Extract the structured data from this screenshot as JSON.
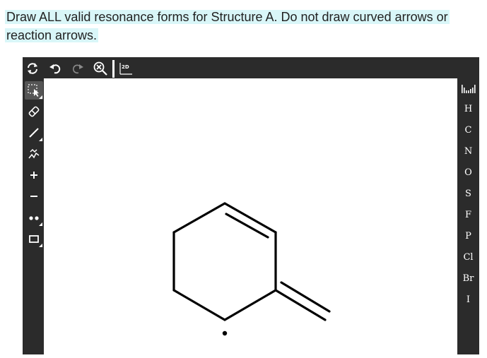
{
  "question": {
    "text": "Draw ALL valid resonance forms for Structure A. Do not draw curved arrows or reaction arrows."
  },
  "toolbar": {
    "tools": [
      "refresh-icon",
      "undo-icon",
      "redo-icon",
      "zoom-clear-icon",
      "layout-2d-icon"
    ],
    "layout_label": "2D"
  },
  "left_tools": [
    "select",
    "erase",
    "bond",
    "chain",
    "charge-plus",
    "charge-minus",
    "radical",
    "shape"
  ],
  "elements": [
    "H",
    "C",
    "N",
    "O",
    "S",
    "F",
    "P",
    "Cl",
    "Br",
    "I"
  ],
  "colors": {
    "highlight": "#d9f6f8",
    "editor_frame": "#2b2b2b"
  }
}
